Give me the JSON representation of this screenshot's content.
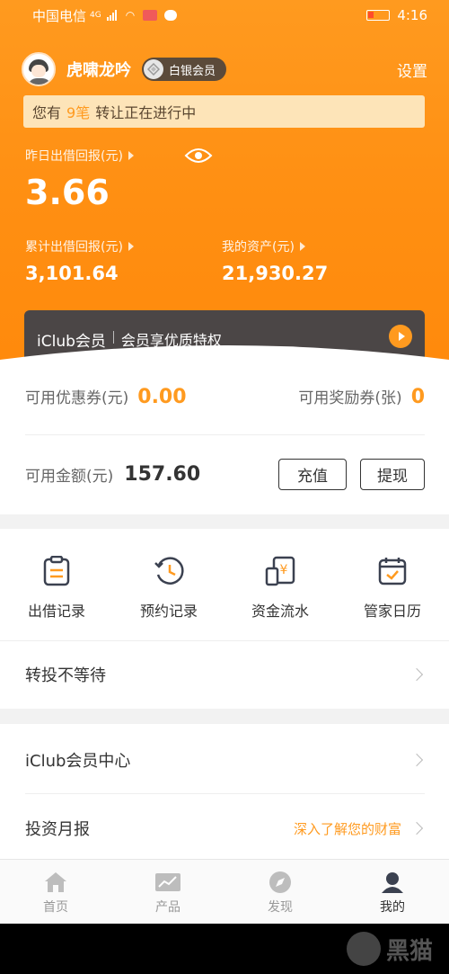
{
  "statusbar": {
    "carrier": "中国电信",
    "network": "4G",
    "time": "4:16"
  },
  "user": {
    "name": "虎啸龙吟",
    "membership": "白银会员",
    "settings_label": "设置"
  },
  "notice": {
    "prefix": "您有",
    "count": "9笔",
    "suffix": "转让正在进行中"
  },
  "earnings": {
    "yesterday_label": "昨日出借回报(元)",
    "yesterday_value": "3.66",
    "total_label": "累计出借回报(元)",
    "total_value": "3,101.64",
    "assets_label": "我的资产(元)",
    "assets_value": "21,930.27"
  },
  "iclub_banner": {
    "brand": "iClub会员",
    "text": "会员享优质特权"
  },
  "wallet": {
    "coupon_label": "可用优惠券(元)",
    "coupon_value": "0.00",
    "reward_label": "可用奖励券(张)",
    "reward_value": "0",
    "balance_label": "可用金额(元)",
    "balance_value": "157.60",
    "recharge_label": "充值",
    "withdraw_label": "提现"
  },
  "quick_actions": [
    {
      "label": "出借记录",
      "icon": "clipboard-icon"
    },
    {
      "label": "预约记录",
      "icon": "clock-history-icon"
    },
    {
      "label": "资金流水",
      "icon": "yen-document-icon"
    },
    {
      "label": "管家日历",
      "icon": "calendar-check-icon"
    }
  ],
  "menu": {
    "reinvest": "转投不等待",
    "iclub_center": "iClub会员中心",
    "monthly_report": "投资月报",
    "monthly_report_hint": "深入了解您的财富"
  },
  "tabs": [
    {
      "label": "首页",
      "icon": "home-icon"
    },
    {
      "label": "产品",
      "icon": "chart-icon"
    },
    {
      "label": "发现",
      "icon": "compass-icon"
    },
    {
      "label": "我的",
      "icon": "user-icon"
    }
  ],
  "watermark": "黑猫",
  "colors": {
    "accent": "#ff9a1f",
    "header": "#ff8f12",
    "banner": "#4b4646"
  }
}
